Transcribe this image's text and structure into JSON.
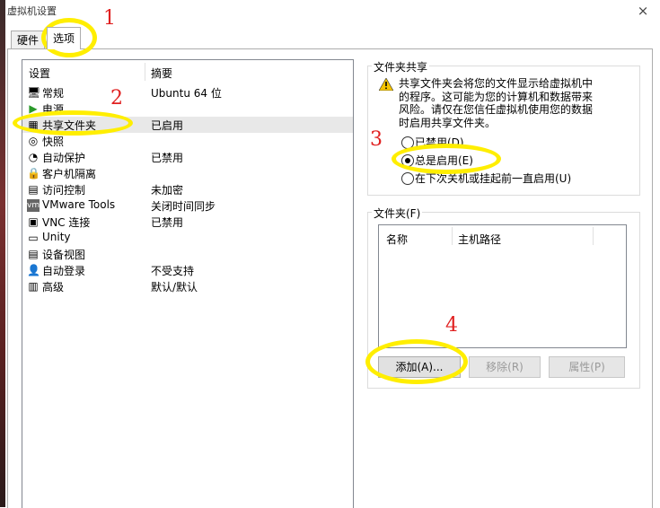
{
  "window": {
    "title": "虚拟机设置",
    "close_icon": "×"
  },
  "tabs": [
    {
      "label": "硬件"
    },
    {
      "label": "选项"
    }
  ],
  "settings_list": {
    "col_setting": "设置",
    "col_summary": "摘要",
    "items": [
      {
        "label": "常规",
        "summary": "Ubuntu 64 位",
        "icon": "monitor-icon",
        "glyph": "🖥"
      },
      {
        "label": "电源",
        "summary": "",
        "icon": "power-play-icon",
        "glyph": "▶"
      },
      {
        "label": "共享文件夹",
        "summary": "已启用",
        "icon": "shared-folder-icon",
        "glyph": "▦"
      },
      {
        "label": "快照",
        "summary": "",
        "icon": "snapshot-icon",
        "glyph": "◎"
      },
      {
        "label": "自动保护",
        "summary": "已禁用",
        "icon": "autoprotect-icon",
        "glyph": "◔"
      },
      {
        "label": "客户机隔离",
        "summary": "",
        "icon": "lock-icon",
        "glyph": "🔒"
      },
      {
        "label": "访问控制",
        "summary": "未加密",
        "icon": "access-control-icon",
        "glyph": "▤"
      },
      {
        "label": "VMware Tools",
        "summary": "关闭时间同步",
        "icon": "vmware-tools-icon",
        "glyph": "vm"
      },
      {
        "label": "VNC 连接",
        "summary": "已禁用",
        "icon": "vnc-icon",
        "glyph": "▣"
      },
      {
        "label": "Unity",
        "summary": "",
        "icon": "unity-icon",
        "glyph": "▭"
      },
      {
        "label": "设备视图",
        "summary": "",
        "icon": "device-view-icon",
        "glyph": "▤"
      },
      {
        "label": "自动登录",
        "summary": "不受支持",
        "icon": "user-icon",
        "glyph": "👤"
      },
      {
        "label": "高级",
        "summary": "默认/默认",
        "icon": "advanced-icon",
        "glyph": "▥"
      }
    ]
  },
  "folder_sharing": {
    "title": "文件夹共享",
    "warning_icon": "warning-icon",
    "warning_text": [
      "共享文件夹会将您的文件显示给虚拟机中",
      "的程序。这可能为您的计算机和数据带来",
      "风险。请仅在您信任虚拟机使用您的数据",
      "时启用共享文件夹。"
    ],
    "options": [
      {
        "label": "已禁用(D)",
        "selected": false
      },
      {
        "label": "总是启用(E)",
        "selected": true
      },
      {
        "label": "在下次关机或挂起前一直启用(U)",
        "selected": false
      }
    ]
  },
  "folders": {
    "title": "文件夹(F)",
    "col_name": "名称",
    "col_host_path": "主机路径",
    "add_button": "添加(A)...",
    "remove_button": "移除(R)",
    "properties_button": "属性(P)"
  },
  "annotations": {
    "step1": "1",
    "step2": "2",
    "step3": "3",
    "step4": "4",
    "color": "#e02020",
    "highlight": "#ffee00"
  }
}
